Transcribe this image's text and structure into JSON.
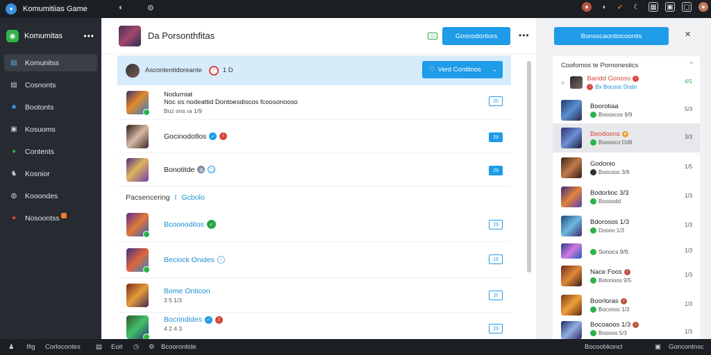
{
  "app": {
    "title": "Komumitiias Game"
  },
  "topbar": {
    "icons": [
      "leaf-icon",
      "gear-icon"
    ],
    "right_icons": [
      "notification-avatar-icon",
      "info-icon",
      "rocket-icon",
      "moon-icon",
      "calendar-icon",
      "image-icon",
      "box-icon",
      "user-avatar-icon"
    ]
  },
  "sidebar": {
    "header": {
      "name": "Komumitas",
      "menu": "•••"
    },
    "items": [
      {
        "label": "Komunitss",
        "icon": "community-icon",
        "active": true
      },
      {
        "label": "Cosnonts",
        "icon": "document-icon"
      },
      {
        "label": "Bootonts",
        "icon": "bookmark-icon"
      },
      {
        "label": "Kosuoms",
        "icon": "grid-icon"
      },
      {
        "label": "Contents",
        "icon": "chat-icon"
      },
      {
        "label": "Kosnior",
        "icon": "users-icon"
      },
      {
        "label": "Kooondes",
        "icon": "globe-icon"
      },
      {
        "label": "Nosoontss",
        "icon": "fire-icon"
      }
    ]
  },
  "main": {
    "title": "Da Porsonthfitas",
    "primary_button": "Goonodortiors",
    "menu": "•••",
    "highlight": {
      "text": "Ascontentidoreante",
      "count": "1 D",
      "button": "Verd Contitnos"
    },
    "rows": [
      {
        "title": "Nodurniat",
        "subtitle_line": "Noc os nodeattid Dontoesdiscos fcoosonooso",
        "sub": "Boz ons ra 1/9",
        "action": "20",
        "filled": false,
        "blue": false
      },
      {
        "title": "Gocinodotlos",
        "sub": "",
        "action": "29",
        "filled": true,
        "blue": false
      },
      {
        "title": "Bonotitde",
        "sub": "",
        "action": "29",
        "filled": true,
        "blue": false
      }
    ],
    "section": {
      "label": "Pacsencering",
      "tab": "Gcbolo"
    },
    "rows2": [
      {
        "title": "Bcoonoditos",
        "sub": "",
        "action": "29",
        "filled": false
      },
      {
        "title": "Beciock Onides",
        "sub": "",
        "action": "19",
        "filled": false
      },
      {
        "title": "Bome Onticon",
        "sub": "3 5 1/3",
        "action": "2I",
        "filled": false
      },
      {
        "title": "Bocrindides",
        "sub": "4 2 4 3",
        "action": "29",
        "filled": false
      }
    ]
  },
  "right": {
    "button": "Bonsocaontiocoontis",
    "close": "✕",
    "list_header": "Coofomos te Pornonestics",
    "items": [
      {
        "title": "Baridd Gonoss",
        "sub": "Bx Bocooc Dodo",
        "time": "4/1",
        "style": "first"
      },
      {
        "title": "Boorotiaa",
        "sub": "Boooscos 9/9",
        "time": "5/3"
      },
      {
        "title": "Beodoons",
        "sub": "Booooco Dd9",
        "time": "3/3",
        "selected": true
      },
      {
        "title": "Godonio",
        "sub": "Boocooc 3/9",
        "time": "1/5"
      },
      {
        "title": "Bodorlioc 3/3",
        "sub": "Boooodd",
        "time": "1/3"
      },
      {
        "title": "Bdorosos 1/3",
        "sub": "Doooo 1/3",
        "time": "1/3"
      },
      {
        "title": "Sonocs 9/9.",
        "sub": "",
        "time": "1/3"
      },
      {
        "title": "Nace Foos",
        "sub": "Botonoos 9/5",
        "time": "1/3"
      },
      {
        "title": "Boorloras",
        "sub": "Boconoc 1/3",
        "time": "1/3"
      },
      {
        "title": "Bocoaoos 1/3",
        "sub": "Booooo 5/3",
        "time": "1/3"
      }
    ]
  },
  "bottombar": {
    "left1": "Ifig",
    "left2": "Corlocontes",
    "mid1": "Eoit",
    "mid2": "Bcoorontide",
    "right1": "Bocoobkoncl",
    "right2": "Goncontnsc"
  }
}
